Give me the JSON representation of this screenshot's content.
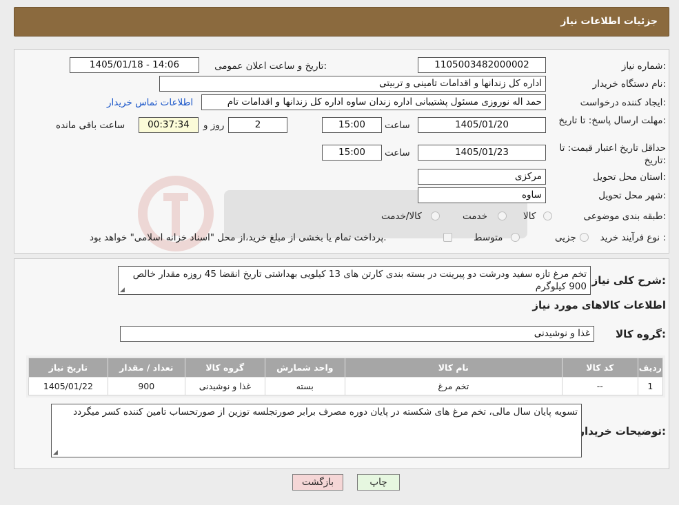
{
  "header": {
    "title": "جزئیات اطلاعات نیاز"
  },
  "form": {
    "need_number_label": "شماره نیاز:",
    "need_number": "1105003482000002",
    "announce_label": "تاریخ و ساعت اعلان عمومی:",
    "announce_value": "1405/01/18 - 14:06",
    "buyer_org_label": "نام دستگاه خریدار:",
    "buyer_org": "اداره کل زندانها و اقدامات تامینی و تربیتی",
    "requester_label": "ایجاد کننده درخواست:",
    "requester": "حمد اله نوروزی مسئول پشتیبانی اداره زندان ساوه اداره کل زندانها و اقدامات تام",
    "contact_link": "اطلاعات تماس خریدار",
    "deadline_label": "مهلت ارسال پاسخ: تا تاریخ:",
    "deadline_date": "1405/01/20",
    "time_label": "ساعت",
    "deadline_time": "15:00",
    "days_value": "2",
    "days_label": "روز و",
    "remaining_time": "00:37:34",
    "remaining_label": "ساعت باقی مانده",
    "validity_label": "حداقل تاریخ اعتبار قیمت: تا تاریخ:",
    "validity_date": "1405/01/23",
    "validity_time_label": "ساعت",
    "validity_time": "15:00",
    "province_label": "استان محل تحویل:",
    "province": "مرکزی",
    "city_label": "شهر محل تحویل:",
    "city": "ساوه",
    "category_label": "طبقه بندی موضوعی:",
    "category_options": [
      "کالا",
      "خدمت",
      "کالا/خدمت"
    ],
    "process_label": "نوع فرآیند خرید :",
    "process_options": [
      "جزیی",
      "متوسط"
    ],
    "process_note": "پرداخت تمام یا بخشی از مبلغ خرید،از محل \"اسناد خزانه اسلامی\" خواهد بود."
  },
  "details": {
    "summary_label": "شرح کلی نیاز:",
    "summary": "تخم مرغ تازه سفید ودرشت دو پیرینت در بسته بندی کارتن های 13 کیلویی بهداشتی تاریخ انقضا 45 روزه مقدار خالص 900 کیلوگرم",
    "goods_info_title": "اطلاعات کالاهای مورد نیاز",
    "goods_group_label": "گروه کالا:",
    "goods_group": "غذا و نوشیدنی"
  },
  "table": {
    "headers": [
      "ردیف",
      "کد کالا",
      "نام کالا",
      "واحد شمارش",
      "گروه کالا",
      "تعداد / مقدار",
      "تاریخ نیاز"
    ],
    "rows": [
      [
        "1",
        "--",
        "تخم مرغ",
        "بسته",
        "غذا و نوشیدنی",
        "900",
        "1405/01/22"
      ]
    ]
  },
  "buyer_notes": {
    "label": "توضیحات خریدار:",
    "text": "تسویه پایان سال مالی، تخم مرغ های شکسته در پایان دوره مصرف برابر صورتجلسه توزین از صورتحساب تامین کننده کسر میگردد"
  },
  "buttons": {
    "print": "چاپ",
    "back": "بازگشت"
  },
  "colors": {
    "header_bg": "#8b6a3e",
    "link": "#1a56c9",
    "table_header": "#a6a6a6",
    "back_button_bg": "#f5d6d6",
    "print_button_bg": "#e6f7e0"
  }
}
